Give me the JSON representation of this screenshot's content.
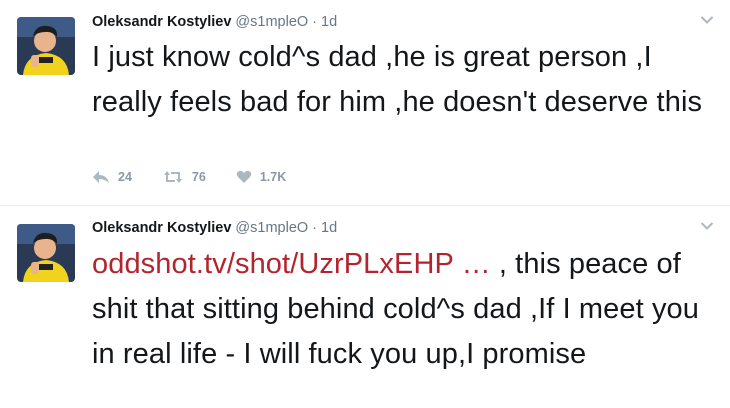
{
  "tweets": [
    {
      "author": "Oleksandr Kostyliev",
      "handle": "@s1mpleO",
      "dot": "·",
      "time": "1d",
      "text": "I just know cold^s dad ,he is great person ,I really feels bad for him ,he doesn't deserve this",
      "actions": {
        "reply": "24",
        "retweet": "76",
        "like": "1.7K"
      }
    },
    {
      "author": "Oleksandr Kostyliev",
      "handle": "@s1mpleO",
      "dot": "·",
      "time": "1d",
      "link": "oddshot.tv/shot/UzrPLxEHP …",
      "text": " , this peace of shit that sitting behind cold^s dad ,If I meet you in real life - I will fuck you up,I promise"
    }
  ],
  "colors": {
    "link": "#b4242f",
    "muted": "#657786",
    "text": "#14171a"
  },
  "icons": [
    "reply-icon",
    "retweet-icon",
    "like-icon",
    "chevron-down-icon"
  ]
}
